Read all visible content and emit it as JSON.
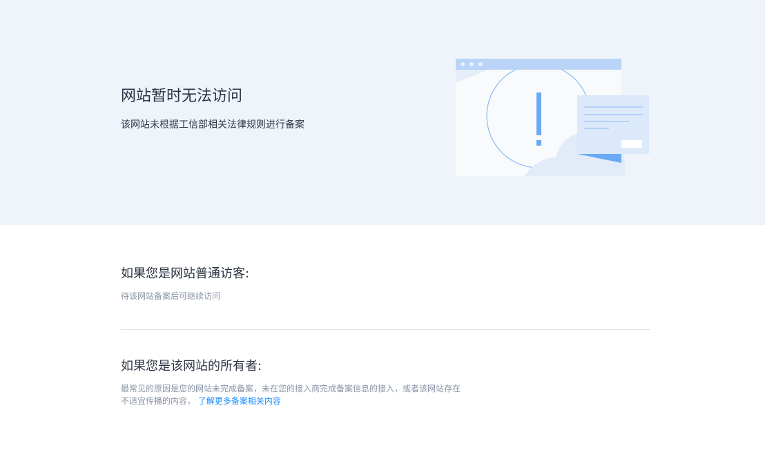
{
  "hero": {
    "title": "网站暂时无法访问",
    "subtitle": "该网站未根据工信部相关法律规则进行备案",
    "illustration_icon": "warning-window-illustration"
  },
  "visitor": {
    "title": "如果您是网站普通访客:",
    "text": "待该网站备案后可继续访问"
  },
  "owner": {
    "title": "如果您是该网站的所有者:",
    "text_line1": "最常见的原因是您的网站未完成备案，未在您的接入商完成备案信息的接入，或者该网站存在",
    "text_line2": "不适宜传播的内容，",
    "link_label": "了解更多备案相关内容"
  },
  "colors": {
    "hero_background": "#eff4fb",
    "accent_blue": "#6aaaf5",
    "link_blue": "#1a8cff",
    "text_dark": "#2b3342",
    "text_muted": "#8a94a6"
  }
}
